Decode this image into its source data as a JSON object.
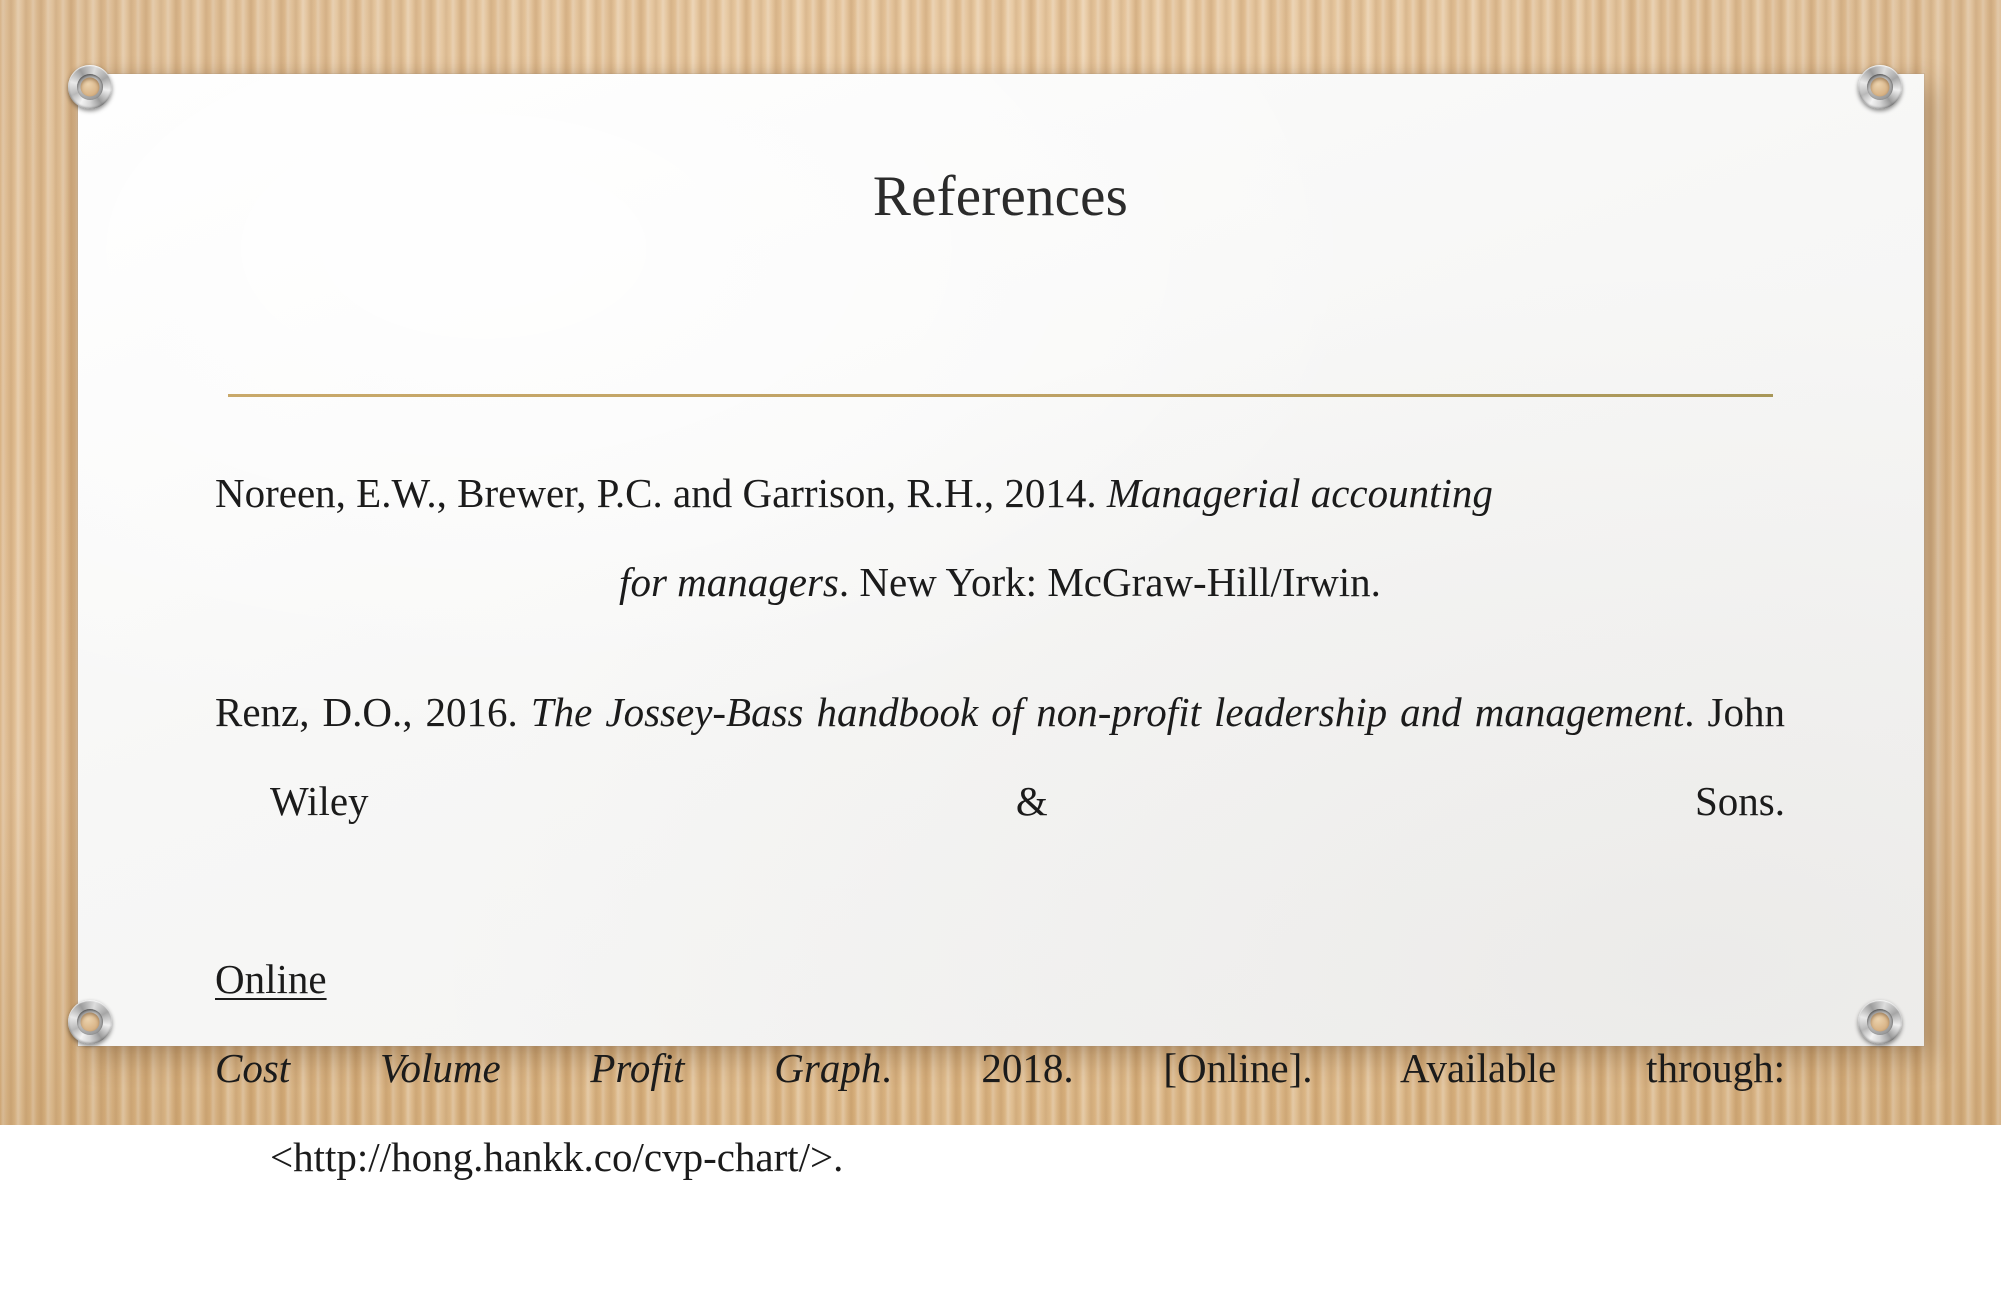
{
  "slide": {
    "title": "References",
    "background": {
      "type": "wood-texture",
      "color": "#e3bf91"
    },
    "card_color": "#f8f8f7",
    "divider_color": "#bfa265"
  },
  "references": {
    "print": [
      {
        "id": "ref-noreen",
        "line1_plain": "Noreen, E.W., Brewer, P.C. and Garrison, R.H., 2014. ",
        "line1_italic": "Managerial accounting",
        "line2_italic": "for managers",
        "line2_plain": ". New York: McGraw-Hill/Irwin."
      },
      {
        "id": "ref-renz",
        "line1_plain": "Renz, D.O., 2016. ",
        "line1_italic": "The Jossey-Bass handbook of non-profit leadership and",
        "line2_italic": "management",
        "line2_plain": ". John Wiley & Sons."
      }
    ],
    "online_heading": "Online",
    "online": [
      {
        "id": "ref-cvp-graph",
        "title_italic": "Cost Volume Profit Graph",
        "rest": ". 2018. [Online]. Available through:",
        "url": "<http://hong.hankk.co/cvp-chart/>."
      }
    ]
  },
  "decorations": {
    "grommets": [
      {
        "name": "grommet-top-left"
      },
      {
        "name": "grommet-top-right"
      },
      {
        "name": "grommet-bottom-left"
      },
      {
        "name": "grommet-bottom-right"
      }
    ]
  }
}
